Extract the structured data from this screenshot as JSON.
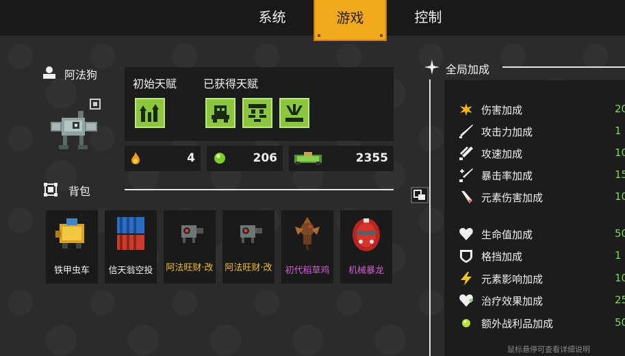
{
  "tabs": [
    {
      "label": "系统",
      "active": false
    },
    {
      "label": "游戏",
      "active": true
    },
    {
      "label": "控制",
      "active": false
    }
  ],
  "character": {
    "name": "阿法狗"
  },
  "talents": {
    "initial_label": "初始天赋",
    "acquired_label": "已获得天赋"
  },
  "stats": [
    {
      "icon": "fire-icon",
      "value": "4"
    },
    {
      "icon": "gem-icon",
      "value": "206"
    },
    {
      "icon": "cash-icon",
      "value": "2355"
    }
  ],
  "backpack": {
    "label": "背包",
    "items": [
      {
        "name": "铁甲虫车",
        "color": "#ffffff"
      },
      {
        "name": "信天翁空投",
        "color": "#ffffff"
      },
      {
        "name": "阿法旺财·改",
        "color": "#f2c12e"
      },
      {
        "name": "阿法旺财·改",
        "color": "#f2c12e"
      },
      {
        "name": "初代稻草鸡",
        "color": "#d65ad6"
      },
      {
        "name": "机械暴龙",
        "color": "#d65ad6"
      }
    ]
  },
  "global_bonus": {
    "title": "全局加成",
    "rows": [
      {
        "icon": "damage-icon",
        "label": "伤害加成",
        "value": "20"
      },
      {
        "icon": "sword-icon",
        "label": "攻击力加成",
        "value": "1"
      },
      {
        "icon": "speed-icon",
        "label": "攻速加成",
        "value": "10"
      },
      {
        "icon": "crit-icon",
        "label": "暴击率加成",
        "value": "15"
      },
      {
        "icon": "element-icon",
        "label": "元素伤害加成",
        "value": "10"
      },
      {
        "icon": "heart-icon",
        "label": "生命值加成",
        "value": "50"
      },
      {
        "icon": "shield-icon",
        "label": "格挡加成",
        "value": "1"
      },
      {
        "icon": "lightning-icon",
        "label": "元素影响加成",
        "value": "10"
      },
      {
        "icon": "heal-icon",
        "label": "治疗效果加成",
        "value": "25"
      },
      {
        "icon": "loot-icon",
        "label": "额外战利品加成",
        "value": "50"
      }
    ],
    "hint": "鼠标悬停可查看详细说明"
  }
}
